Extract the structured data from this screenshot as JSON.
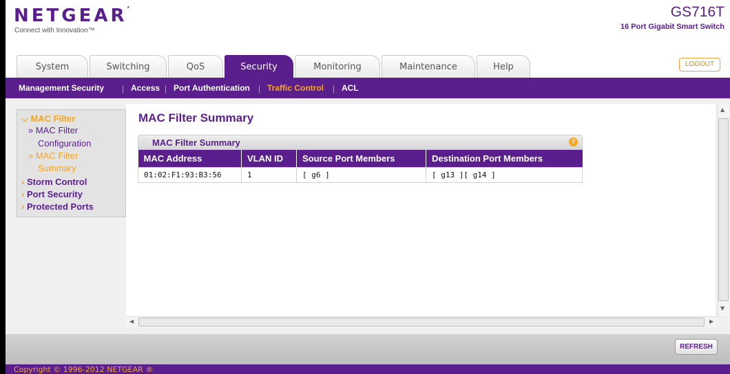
{
  "header": {
    "brand": "NETGEAR",
    "tagline": "Connect with Innovation™",
    "model": "GS716T",
    "model_desc": "16 Port Gigabit Smart Switch",
    "logout_label": "LOGOUT"
  },
  "tabs": [
    {
      "label": "System"
    },
    {
      "label": "Switching"
    },
    {
      "label": "QoS"
    },
    {
      "label": "Security"
    },
    {
      "label": "Monitoring"
    },
    {
      "label": "Maintenance"
    },
    {
      "label": "Help"
    }
  ],
  "subnav": [
    {
      "label": "Management Security"
    },
    {
      "label": "Access"
    },
    {
      "label": "Port Authentication"
    },
    {
      "label": "Traffic Control"
    },
    {
      "label": "ACL"
    }
  ],
  "sidebar": {
    "mac_filter": "MAC Filter",
    "mac_filter_config_1": "» MAC Filter",
    "mac_filter_config_2": "Configuration",
    "mac_filter_summary_1": "» MAC Filter",
    "mac_filter_summary_2": "Summary",
    "storm_control": "Storm Control",
    "port_security": "Port Security",
    "protected_ports": "Protected Ports"
  },
  "main": {
    "page_title": "MAC Filter Summary",
    "panel_title": "MAC Filter Summary",
    "help": "?",
    "columns": [
      "MAC Address",
      "VLAN ID",
      "Source Port Members",
      "Destination Port Members"
    ],
    "rows": [
      [
        "01:02:F1:93:B3:56",
        "1",
        "[ g6 ]",
        "[ g13 ][ g14 ]"
      ]
    ]
  },
  "footer": {
    "refresh_label": "REFRESH",
    "copyright": "Copyright © 1996-2012 NETGEAR ®"
  },
  "colors": {
    "brand_purple": "#5a1f8c",
    "accent_orange": "#f5a623"
  }
}
